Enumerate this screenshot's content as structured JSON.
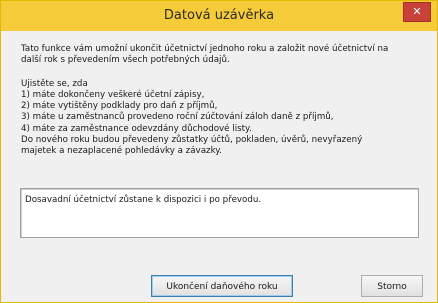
{
  "window": {
    "title": "Datová uzávěrka",
    "close_glyph": "✕"
  },
  "colors": {
    "titlebar": "#f6cb3a",
    "close_button": "#c8423a",
    "dialog_background": "#f0f0f0"
  },
  "intro": [
    "Tato funkce vám umožní ukončit účetnictví jednoho roku a založit nové účetnictví na",
    "další rok s převedením všech potřebných údajů."
  ],
  "checklist": [
    "Ujistěte se, zda",
    "1) máte dokončeny veškeré účetní zápisy,",
    "2) máte vytištěny podklady pro daň z příjmů,",
    "3) máte u zaměstnanců provedeno roční zúčtování záloh daně z příjmů,",
    "4) máte za zaměstnance odevzdány důchodové listy.",
    "Do nového roku budou převedeny zůstatky účtů, pokladen, úvěrů, nevyřazený",
    "majetek a nezaplacené pohledávky a závazky."
  ],
  "notice": "Dosavadní účetnictví zůstane k dispozici i po převodu.",
  "buttons": {
    "primary": "Ukončení daňového roku",
    "cancel": "Storno"
  }
}
